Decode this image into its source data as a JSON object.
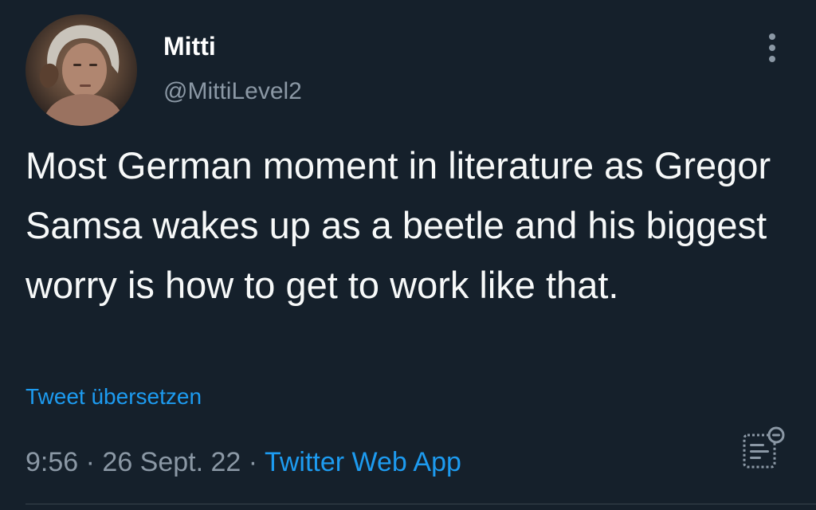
{
  "tweet": {
    "author": {
      "display_name": "Mitti",
      "handle": "@MittiLevel2",
      "avatar_icon": "profile-photo"
    },
    "text": "Most German moment in literature as Gregor Samsa wakes up as a beetle and his biggest worry is how to get to work like that.",
    "translate_label": "Tweet übersetzen",
    "time": "9:56",
    "separator": "·",
    "date": "26 Sept. 22",
    "source": "Twitter Web App",
    "more_icon": "vertical-ellipsis-icon",
    "analytics_icon": "view-tweet-analytics-icon"
  },
  "colors": {
    "background": "#15202b",
    "text_primary": "#f7f9f9",
    "text_secondary": "#8b98a5",
    "accent": "#1d9bf0",
    "divider": "#38444d"
  }
}
